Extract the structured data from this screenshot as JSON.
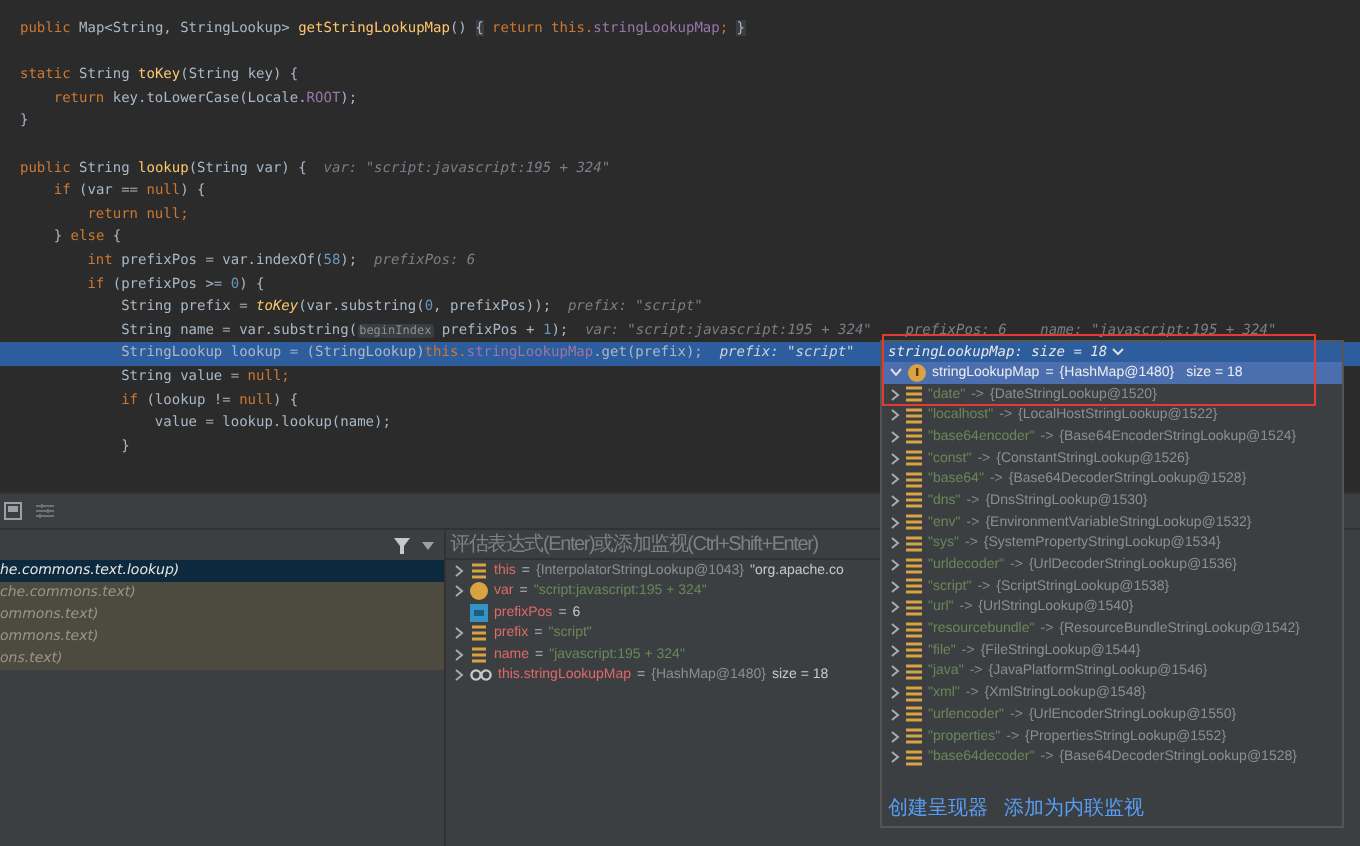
{
  "code": {
    "lines": [
      {
        "highlighted": false,
        "segments": [
          {
            "t": "public ",
            "kind": "kw"
          },
          {
            "t": "Map<String, StringLookup> ",
            "kind": "plain"
          },
          {
            "t": "getStringLookupMap",
            "kind": "method"
          },
          {
            "t": "() ",
            "kind": "plain"
          },
          {
            "t": "{",
            "kind": "fold"
          },
          {
            "t": " return ",
            "kind": "kw"
          },
          {
            "t": "this.",
            "kind": "kw"
          },
          {
            "t": "stringLookupMap",
            "kind": "field"
          },
          {
            "t": "; ",
            "kind": "kw"
          },
          {
            "t": "}",
            "kind": "fold"
          }
        ]
      },
      {
        "highlighted": false
      },
      {
        "highlighted": false,
        "segments": [
          {
            "t": "static ",
            "kind": "kw"
          },
          {
            "t": "String ",
            "kind": "plain"
          },
          {
            "t": "toKey",
            "kind": "method"
          },
          {
            "t": "(String key) {",
            "kind": "plain"
          }
        ]
      },
      {
        "highlighted": false,
        "segments": [
          {
            "t": "    return ",
            "kind": "kw"
          },
          {
            "t": "key.toLowerCase(Locale.",
            "kind": "plain"
          },
          {
            "t": "ROOT",
            "kind": "field"
          },
          {
            "t": ");",
            "kind": "plain"
          }
        ]
      },
      {
        "highlighted": false,
        "segments": [
          {
            "t": "}",
            "kind": "plain"
          }
        ]
      },
      {
        "highlighted": false
      },
      {
        "highlighted": false,
        "segments": [
          {
            "t": "public ",
            "kind": "kw"
          },
          {
            "t": "String ",
            "kind": "plain"
          },
          {
            "t": "lookup",
            "kind": "method"
          },
          {
            "t": "(String var) {  ",
            "kind": "plain"
          },
          {
            "t": "var: \"script:javascript:195 + 324\"",
            "kind": "hint"
          }
        ]
      },
      {
        "highlighted": false,
        "segments": [
          {
            "t": "    if ",
            "kind": "kw"
          },
          {
            "t": "(var == ",
            "kind": "plain"
          },
          {
            "t": "null",
            "kind": "kw"
          },
          {
            "t": ") {",
            "kind": "plain"
          }
        ]
      },
      {
        "highlighted": false,
        "segments": [
          {
            "t": "        return null",
            "kind": "kw"
          },
          {
            "t": ";",
            "kind": "kw"
          }
        ]
      },
      {
        "highlighted": false,
        "segments": [
          {
            "t": "    } ",
            "kind": "plain"
          },
          {
            "t": "else ",
            "kind": "kw"
          },
          {
            "t": "{",
            "kind": "plain"
          }
        ]
      },
      {
        "highlighted": false,
        "segments": [
          {
            "t": "        int ",
            "kind": "kw"
          },
          {
            "t": "prefixPos = var.indexOf(",
            "kind": "plain"
          },
          {
            "t": "58",
            "kind": "num"
          },
          {
            "t": ");  ",
            "kind": "plain"
          },
          {
            "t": "prefixPos: 6",
            "kind": "hint"
          }
        ]
      },
      {
        "highlighted": false,
        "segments": [
          {
            "t": "        if ",
            "kind": "kw"
          },
          {
            "t": "(prefixPos >= ",
            "kind": "plain"
          },
          {
            "t": "0",
            "kind": "num"
          },
          {
            "t": ") {",
            "kind": "plain"
          }
        ]
      },
      {
        "highlighted": false,
        "segments": [
          {
            "t": "            String prefix = ",
            "kind": "plain"
          },
          {
            "t": "toKey",
            "kind": "italic"
          },
          {
            "t": "(var.substring(",
            "kind": "plain"
          },
          {
            "t": "0",
            "kind": "num"
          },
          {
            "t": ", prefixPos));  ",
            "kind": "plain"
          },
          {
            "t": "prefix: \"script\"",
            "kind": "hint"
          }
        ]
      },
      {
        "highlighted": false,
        "segments": [
          {
            "t": "            String name = var.substring(",
            "kind": "plain"
          },
          {
            "t": "beginIndex",
            "kind": "inlay"
          },
          {
            "t": " prefixPos + ",
            "kind": "plain"
          },
          {
            "t": "1",
            "kind": "num"
          },
          {
            "t": ");  ",
            "kind": "plain"
          },
          {
            "t": "var: \"script:javascript:195 + 324\"    prefixPos: 6    name: \"javascript:195 + 324\"",
            "kind": "hint"
          }
        ]
      },
      {
        "highlighted": true,
        "segments": [
          {
            "t": "            StringLookup lookup = (StringLookup)",
            "kind": "plain"
          },
          {
            "t": "this.",
            "kind": "kw"
          },
          {
            "t": "stringLookupMap",
            "kind": "field"
          },
          {
            "t": ".get(prefix);  ",
            "kind": "plain"
          },
          {
            "t": "prefix: \"script\"",
            "kind": "hint"
          }
        ]
      },
      {
        "highlighted": false,
        "segments": [
          {
            "t": "            String value = ",
            "kind": "plain"
          },
          {
            "t": "null",
            "kind": "kw"
          },
          {
            "t": ";",
            "kind": "kw"
          }
        ]
      },
      {
        "highlighted": false,
        "segments": [
          {
            "t": "            if ",
            "kind": "kw"
          },
          {
            "t": "(lookup != ",
            "kind": "plain"
          },
          {
            "t": "null",
            "kind": "kw"
          },
          {
            "t": ") {",
            "kind": "plain"
          }
        ]
      },
      {
        "highlighted": false,
        "segments": [
          {
            "t": "                value = lookup.lookup(name);",
            "kind": "plain"
          }
        ]
      },
      {
        "highlighted": false,
        "segments": [
          {
            "t": "            }",
            "kind": "plain"
          }
        ]
      }
    ]
  },
  "frames": {
    "rows": [
      {
        "text": "he.commons.text.lookup)",
        "selected": true
      },
      {
        "text": "che.commons.text)",
        "selected": false
      },
      {
        "text": "ommons.text)",
        "selected": false
      },
      {
        "text": "ommons.text)",
        "selected": false
      },
      {
        "text": "ons.text)",
        "selected": false
      }
    ]
  },
  "variables": {
    "placeholder": "评估表达式(Enter)或添加监视(Ctrl+Shift+Enter)",
    "rows": [
      {
        "kind": "field",
        "expandable": true,
        "name": "this",
        "value": [
          {
            "t": "=",
            "kind": "op"
          },
          {
            "t": "{InterpolatorStringLookup@1043}",
            "kind": "obj"
          },
          {
            "t": "\"org.apache.co",
            "kind": "plain"
          }
        ]
      },
      {
        "kind": "param",
        "expandable": true,
        "name": "var",
        "value": [
          {
            "t": "=",
            "kind": "op"
          },
          {
            "t": "\"script:javascript:195 + 324\"",
            "kind": "str"
          }
        ]
      },
      {
        "kind": "int",
        "expandable": false,
        "name": "prefixPos",
        "value": [
          {
            "t": "=",
            "kind": "op"
          },
          {
            "t": "6",
            "kind": "plain"
          }
        ]
      },
      {
        "kind": "field",
        "expandable": true,
        "name": "prefix",
        "value": [
          {
            "t": "=",
            "kind": "op"
          },
          {
            "t": "\"script\"",
            "kind": "str"
          }
        ]
      },
      {
        "kind": "field",
        "expandable": true,
        "name": "name",
        "value": [
          {
            "t": "=",
            "kind": "op"
          },
          {
            "t": "\"javascript:195 + 324\"",
            "kind": "str"
          }
        ]
      },
      {
        "kind": "watch",
        "expandable": true,
        "name": "this.stringLookupMap",
        "value": [
          {
            "t": "=",
            "kind": "op"
          },
          {
            "t": "{HashMap@1480}",
            "kind": "obj"
          },
          {
            "t": "size = 18",
            "kind": "plain"
          }
        ]
      }
    ]
  },
  "popup": {
    "header": "stringLookupMap:  size = 18",
    "root": {
      "name": "stringLookupMap",
      "equals": "=",
      "value": "{HashMap@1480}",
      "size": "size = 18",
      "selected": true,
      "expanded": true
    },
    "entries": [
      {
        "key": "\"date\"",
        "arrow": "->",
        "value": "{DateStringLookup@1520}"
      },
      {
        "key": "\"localhost\"",
        "arrow": "->",
        "value": "{LocalHostStringLookup@1522}"
      },
      {
        "key": "\"base64encoder\"",
        "arrow": "->",
        "value": "{Base64EncoderStringLookup@1524}"
      },
      {
        "key": "\"const\"",
        "arrow": "->",
        "value": "{ConstantStringLookup@1526}"
      },
      {
        "key": "\"base64\"",
        "arrow": "->",
        "value": "{Base64DecoderStringLookup@1528}"
      },
      {
        "key": "\"dns\"",
        "arrow": "->",
        "value": "{DnsStringLookup@1530}"
      },
      {
        "key": "\"env\"",
        "arrow": "->",
        "value": "{EnvironmentVariableStringLookup@1532}"
      },
      {
        "key": "\"sys\"",
        "arrow": "->",
        "value": "{SystemPropertyStringLookup@1534}"
      },
      {
        "key": "\"urldecoder\"",
        "arrow": "->",
        "value": "{UrlDecoderStringLookup@1536}"
      },
      {
        "key": "\"script\"",
        "arrow": "->",
        "value": "{ScriptStringLookup@1538}"
      },
      {
        "key": "\"url\"",
        "arrow": "->",
        "value": "{UrlStringLookup@1540}"
      },
      {
        "key": "\"resourcebundle\"",
        "arrow": "->",
        "value": "{ResourceBundleStringLookup@1542}"
      },
      {
        "key": "\"file\"",
        "arrow": "->",
        "value": "{FileStringLookup@1544}"
      },
      {
        "key": "\"java\"",
        "arrow": "->",
        "value": "{JavaPlatformStringLookup@1546}"
      },
      {
        "key": "\"xml\"",
        "arrow": "->",
        "value": "{XmlStringLookup@1548}"
      },
      {
        "key": "\"urlencoder\"",
        "arrow": "->",
        "value": "{UrlEncoderStringLookup@1550}"
      },
      {
        "key": "\"properties\"",
        "arrow": "->",
        "value": "{PropertiesStringLookup@1552}"
      },
      {
        "key": "\"base64decoder\"",
        "arrow": "->",
        "value": "{Base64DecoderStringLookup@1528}"
      }
    ],
    "links": [
      "创建呈现器",
      "添加为内联监视"
    ]
  }
}
